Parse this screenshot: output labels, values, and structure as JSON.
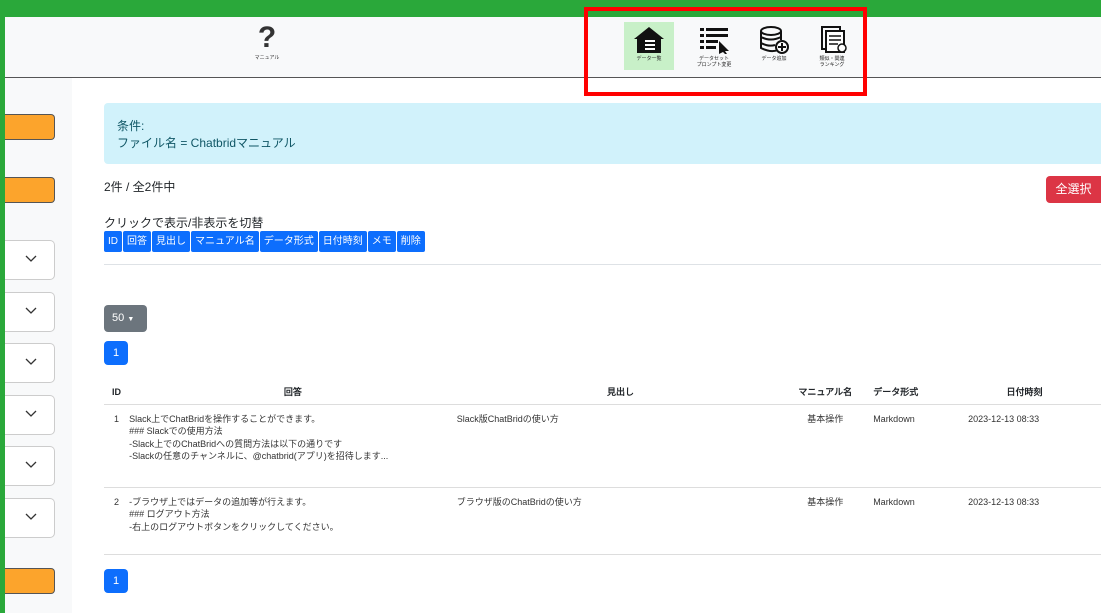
{
  "header": {
    "help_label": "マニュアル",
    "nav": [
      {
        "label": "データ一覧",
        "icon": "house-data-icon"
      },
      {
        "label": "データセット\nプロンプト変更",
        "icon": "list-cursor-icon"
      },
      {
        "label": "データ追加",
        "icon": "database-add-icon"
      },
      {
        "label": "類似・関連\nランキング",
        "icon": "ranking-document-icon"
      }
    ]
  },
  "condition": {
    "title": "条件:",
    "text": "ファイル名 = Chatbridマニュアル"
  },
  "count_text": "2件 / 全2件中",
  "select_all_label": "全選択",
  "toggle_title": "クリックで表示/非表示を切替",
  "columns_toggle": [
    "ID",
    "回答",
    "見出し",
    "マニュアル名",
    "データ形式",
    "日付時刻",
    "メモ",
    "削除"
  ],
  "per_page": "50",
  "page_number": "1",
  "table": {
    "headers": [
      "ID",
      "回答",
      "見出し",
      "マニュアル名",
      "データ形式",
      "日付時刻"
    ],
    "rows": [
      {
        "id": "1",
        "answer": [
          "Slack上でChatBridを操作することができます。",
          "### Slackでの使用方法",
          "-Slack上でのChatBridへの質問方法は以下の通りです",
          "-Slackの任意のチャンネルに、@chatbrid(アプリ)を招待します..."
        ],
        "heading": "Slack版ChatBridの使い方",
        "manual": "基本操作",
        "format": "Markdown",
        "datetime": "2023-12-13 08:33"
      },
      {
        "id": "2",
        "answer": [
          "-ブラウザ上ではデータの追加等が行えます。",
          "### ログアウト方法",
          "-右上のログアウトボタンをクリックしてください。"
        ],
        "heading": "ブラウザ版のChatBridの使い方",
        "manual": "基本操作",
        "format": "Markdown",
        "datetime": "2023-12-13 08:33"
      }
    ]
  },
  "colors": {
    "green": "#2aa83a",
    "orange": "#fca42c",
    "primary": "#0d6efd",
    "danger": "#dc3545",
    "highlight": "#ff0000"
  }
}
